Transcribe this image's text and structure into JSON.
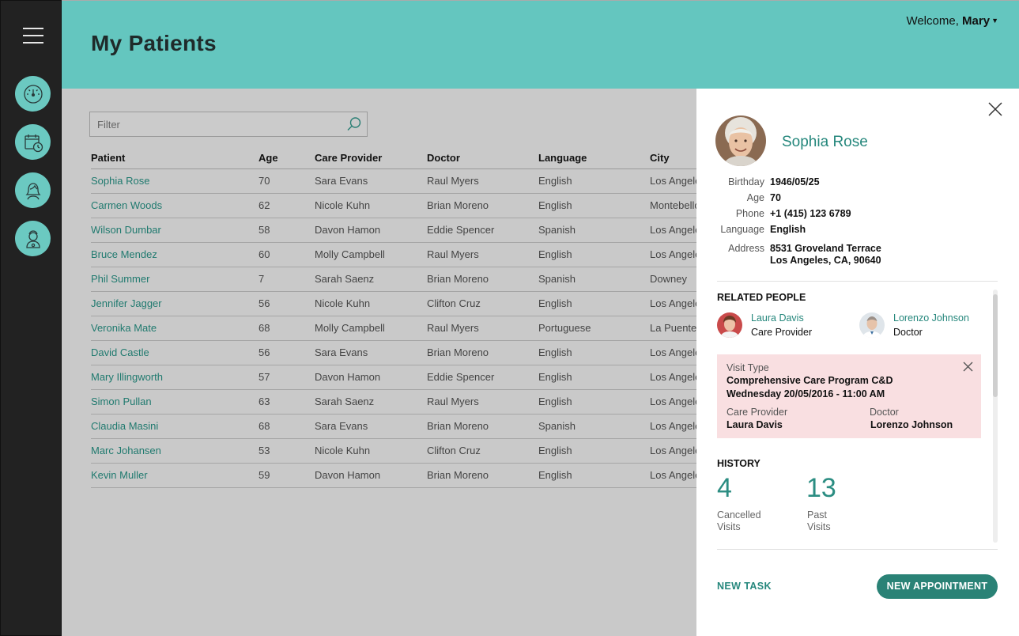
{
  "header": {
    "title": "My Patients",
    "welcome_prefix": "Welcome,",
    "user_name": "Mary"
  },
  "sidebar": {
    "items": [
      {
        "icon": "dashboard-gauge-icon"
      },
      {
        "icon": "calendar-clock-icon"
      },
      {
        "icon": "care-provider-icon"
      },
      {
        "icon": "doctor-icon"
      }
    ]
  },
  "filter": {
    "placeholder": "Filter"
  },
  "table": {
    "columns": [
      "Patient",
      "Age",
      "Care Provider",
      "Doctor",
      "Language",
      "City"
    ],
    "rows": [
      [
        "Sophia Rose",
        "70",
        "Sara Evans",
        "Raul Myers",
        "English",
        "Los Angeles"
      ],
      [
        "Carmen Woods",
        "62",
        "Nicole Kuhn",
        "Brian Moreno",
        "English",
        "Montebello"
      ],
      [
        "Wilson Dumbar",
        "58",
        "Davon Hamon",
        "Eddie Spencer",
        "Spanish",
        "Los Angeles"
      ],
      [
        "Bruce Mendez",
        "60",
        "Molly Campbell",
        "Raul Myers",
        "English",
        "Los Angeles"
      ],
      [
        "Phil Summer",
        "7",
        "Sarah Saenz",
        "Brian Moreno",
        "Spanish",
        "Downey"
      ],
      [
        "Jennifer Jagger",
        "56",
        "Nicole Kuhn",
        "Clifton Cruz",
        "English",
        "Los Angeles"
      ],
      [
        "Veronika Mate",
        "68",
        "Molly Campbell",
        "Raul Myers",
        "Portuguese",
        "La Puente"
      ],
      [
        "David Castle",
        "56",
        "Sara Evans",
        "Brian Moreno",
        "English",
        "Los Angeles"
      ],
      [
        "Mary Illingworth",
        "57",
        "Davon Hamon",
        "Eddie Spencer",
        "English",
        "Los Angeles"
      ],
      [
        "Simon Pullan",
        "63",
        "Sarah Saenz",
        "Raul Myers",
        "English",
        "Los Angeles"
      ],
      [
        "Claudia Masini",
        "68",
        "Sara Evans",
        "Brian Moreno",
        "Spanish",
        "Los Angeles"
      ],
      [
        "Marc Johansen",
        "53",
        "Nicole Kuhn",
        "Clifton Cruz",
        "English",
        "Los Angeles"
      ],
      [
        "Kevin Muller",
        "59",
        "Davon Hamon",
        "Brian Moreno",
        "English",
        "Los Angeles"
      ]
    ]
  },
  "panel": {
    "name": "Sophia Rose",
    "info": [
      {
        "label": "Birthday",
        "value": "1946/05/25"
      },
      {
        "label": "Age",
        "value": "70"
      },
      {
        "label": "Phone",
        "value": "+1 (415) 123 6789"
      },
      {
        "label": "Language",
        "value": "English"
      },
      {
        "label": "Address",
        "value": "8531 Groveland Terrace",
        "value2": "Los Angeles, CA, 90640"
      }
    ],
    "related_title": "RELATED PEOPLE",
    "related": [
      {
        "name": "Laura Davis",
        "role": "Care Provider"
      },
      {
        "name": "Lorenzo Johnson",
        "role": "Doctor"
      }
    ],
    "visit": {
      "label": "Visit Type",
      "program": "Comprehensive Care Program C&D",
      "date": "Wednesday 20/05/2016 - 11:00 AM",
      "care_provider_label": "Care Provider",
      "care_provider": "Laura Davis",
      "doctor_label": "Doctor",
      "doctor": "Lorenzo Johnson"
    },
    "history_title": "HISTORY",
    "history": [
      {
        "count": "4",
        "label_line1": "Cancelled",
        "label_line2": "Visits"
      },
      {
        "count": "13",
        "label_line1": "Past",
        "label_line2": "Visits"
      }
    ],
    "actions": {
      "new_task": "NEW TASK",
      "new_appointment": "NEW APPOINTMENT"
    }
  },
  "colors": {
    "header_teal": "#64c6bf",
    "sidebar_dark": "#222222",
    "accent_teal": "#2a8276",
    "link_teal": "#25877c",
    "visit_pink": "#f9dfe1"
  }
}
